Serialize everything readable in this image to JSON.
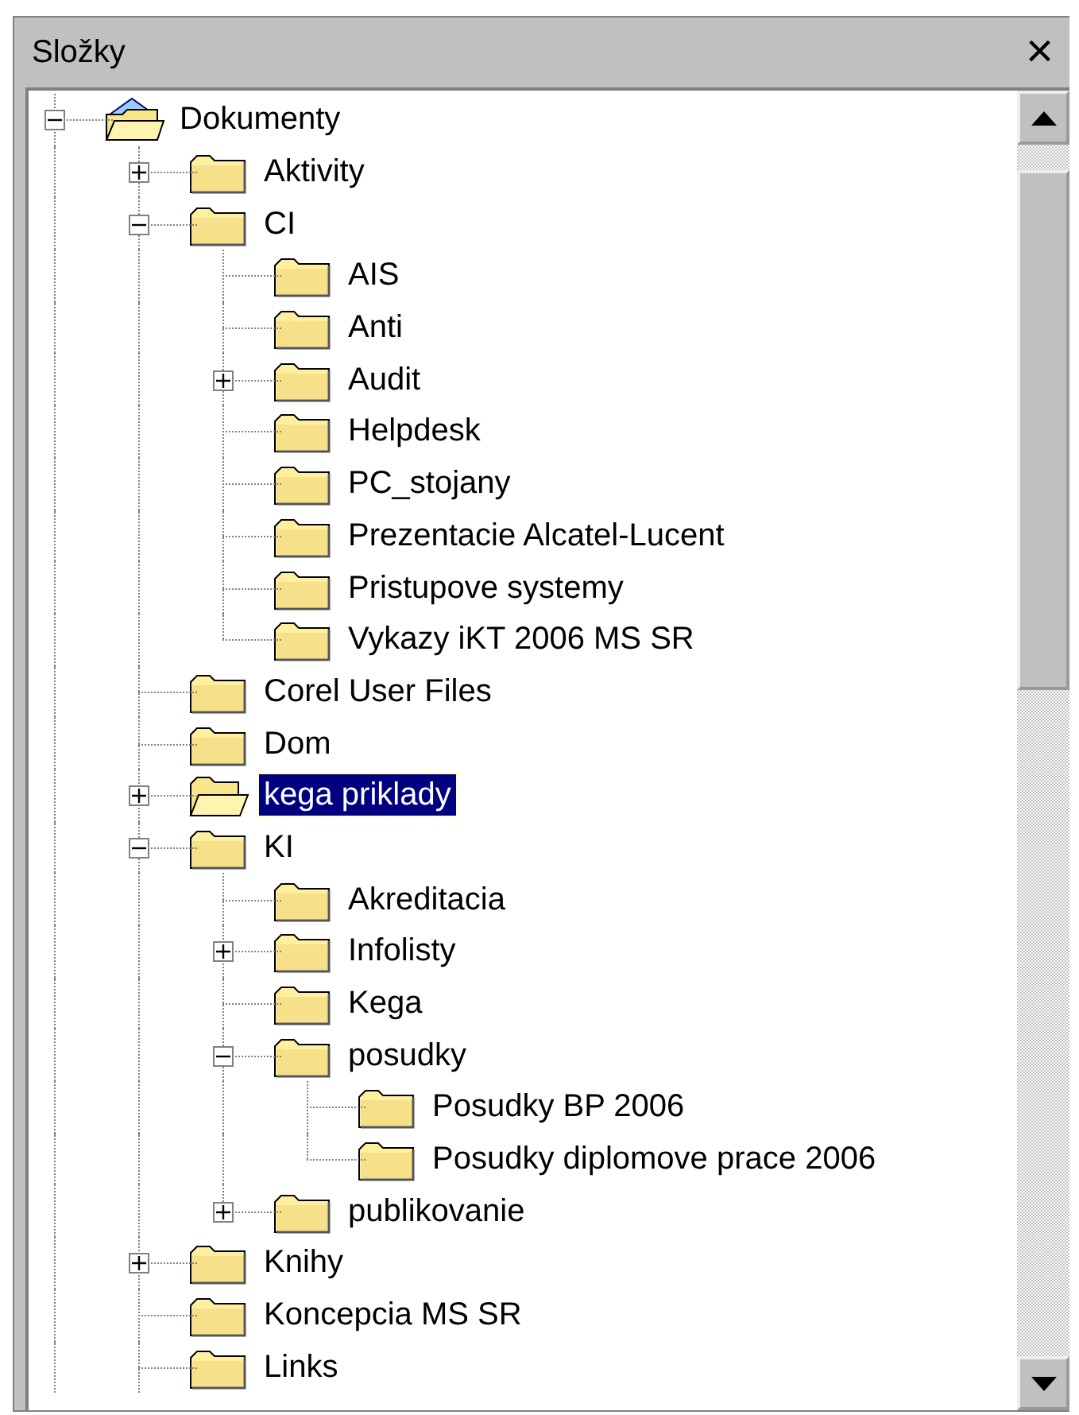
{
  "panel": {
    "title": "Složky",
    "close": "×"
  },
  "tree": [
    {
      "label": "Dokumenty",
      "kind": "documents",
      "expanded": true,
      "selected": false,
      "children": [
        {
          "label": "Aktivity",
          "kind": "folder",
          "expanded": false,
          "selected": false
        },
        {
          "label": "CI",
          "kind": "folder",
          "expanded": true,
          "selected": false,
          "children": [
            {
              "label": "AIS",
              "kind": "folder",
              "selected": false
            },
            {
              "label": "Anti",
              "kind": "folder",
              "selected": false
            },
            {
              "label": "Audit",
              "kind": "folder",
              "expanded": false,
              "selected": false
            },
            {
              "label": "Helpdesk",
              "kind": "folder",
              "selected": false
            },
            {
              "label": "PC_stojany",
              "kind": "folder",
              "selected": false
            },
            {
              "label": "Prezentacie Alcatel-Lucent",
              "kind": "folder",
              "selected": false
            },
            {
              "label": "Pristupove systemy",
              "kind": "folder",
              "selected": false
            },
            {
              "label": "Vykazy iKT 2006 MS SR",
              "kind": "folder",
              "selected": false
            }
          ]
        },
        {
          "label": "Corel User Files",
          "kind": "folder",
          "selected": false
        },
        {
          "label": "Dom",
          "kind": "folder",
          "selected": false
        },
        {
          "label": "kega priklady",
          "kind": "folder",
          "expanded": false,
          "selected": true
        },
        {
          "label": "KI",
          "kind": "folder",
          "expanded": true,
          "selected": false,
          "children": [
            {
              "label": "Akreditacia",
              "kind": "folder",
              "selected": false
            },
            {
              "label": "Infolisty",
              "kind": "folder",
              "expanded": false,
              "selected": false
            },
            {
              "label": "Kega",
              "kind": "folder",
              "selected": false
            },
            {
              "label": "posudky",
              "kind": "folder",
              "expanded": true,
              "selected": false,
              "children": [
                {
                  "label": "Posudky BP 2006",
                  "kind": "folder",
                  "selected": false
                },
                {
                  "label": "Posudky diplomove prace 2006",
                  "kind": "folder",
                  "selected": false
                }
              ]
            },
            {
              "label": "publikovanie",
              "kind": "folder",
              "expanded": false,
              "selected": false
            }
          ]
        },
        {
          "label": "Knihy",
          "kind": "folder",
          "expanded": false,
          "selected": false
        },
        {
          "label": "Koncepcia MS SR",
          "kind": "folder",
          "selected": false
        },
        {
          "label": "Links",
          "kind": "folder",
          "selected": false
        }
      ]
    }
  ]
}
